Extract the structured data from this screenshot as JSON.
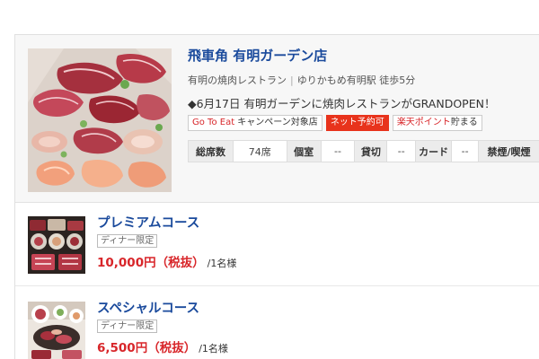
{
  "shop": {
    "name": "飛車角 有明ガーデン店",
    "genre": "有明の焼肉レストラン",
    "access": "ゆりかもめ有明駅 徒歩5分",
    "catchcopy": "◆6月17日 有明ガーデンに焼肉レストランがGRANDOPEN！",
    "badges": {
      "gotoeat_brand": "Go To Eat",
      "gotoeat_rest": " キャンペーン対象店",
      "net_reservation": "ネット予約可",
      "rakuten_brand": "楽天ポイント",
      "rakuten_rest": "貯まる"
    },
    "specs": [
      {
        "label": "総席数",
        "value": "74席"
      },
      {
        "label": "個室",
        "value": "--"
      },
      {
        "label": "貸切",
        "value": "--"
      },
      {
        "label": "カード",
        "value": "--"
      },
      {
        "label": "禁煙/喫煙",
        "value": ""
      }
    ]
  },
  "courses": [
    {
      "name": "プレミアムコース",
      "tag": "ディナー限定",
      "price": "10,000円（税抜）",
      "per": "/1名様"
    },
    {
      "name": "スペシャルコース",
      "tag": "ディナー限定",
      "price": "6,500円（税抜）",
      "per": "/1名様"
    }
  ],
  "colors": {
    "link_blue": "#1a4a9c",
    "price_red": "#d8262a",
    "net_badge_red": "#e8331c"
  },
  "icons": {
    "shop_photo": "grilled-meat-platter-photo",
    "course_photo": "yakiniku-course-spread-photo"
  }
}
